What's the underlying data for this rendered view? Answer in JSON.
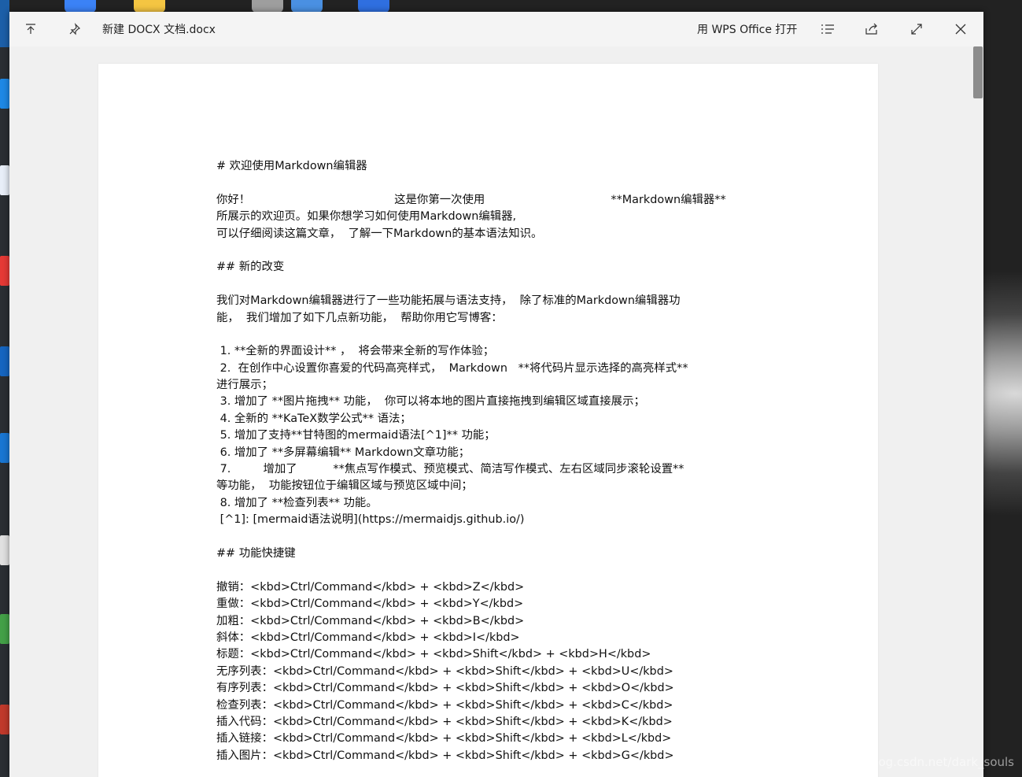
{
  "window": {
    "title": "新建 DOCX 文档.docx",
    "open_with_label": "用 WPS Office 打开"
  },
  "icons": {
    "move_up": "arrow-up-icon",
    "pin": "pin-icon",
    "list": "list-icon",
    "share": "share-icon",
    "fullscreen": "fullscreen-icon",
    "close": "close-icon"
  },
  "document": {
    "lines": [
      "# 欢迎使用Markdown编辑器",
      "",
      "你好！                                        这是你第一次使用                                   **Markdown编辑器**",
      "所展示的欢迎页。如果你想学习如何使用Markdown编辑器,",
      "可以仔细阅读这篇文章，  了解一下Markdown的基本语法知识。",
      "",
      "## 新的改变",
      "",
      "我们对Markdown编辑器进行了一些功能拓展与语法支持，  除了标准的Markdown编辑器功",
      "能，  我们增加了如下几点新功能，  帮助你用它写博客：",
      "",
      " 1. **全新的界面设计** ，  将会带来全新的写作体验；",
      " 2.  在创作中心设置你喜爱的代码高亮样式，  Markdown   **将代码片显示选择的高亮样式**",
      "进行展示；",
      " 3. 增加了 **图片拖拽** 功能，  你可以将本地的图片直接拖拽到编辑区域直接展示；",
      " 4. 全新的 **KaTeX数学公式** 语法；",
      " 5. 增加了支持**甘特图的mermaid语法[^1]** 功能；",
      " 6. 增加了 **多屏幕编辑** Markdown文章功能；",
      " 7.         增加了          **焦点写作模式、预览模式、简洁写作模式、左右区域同步滚轮设置**",
      "等功能，  功能按钮位于编辑区域与预览区域中间；",
      " 8. 增加了 **检查列表** 功能。",
      " [^1]: [mermaid语法说明](https://mermaidjs.github.io/)",
      "",
      "## 功能快捷键",
      "",
      "撤销：<kbd>Ctrl/Command</kbd> + <kbd>Z</kbd>",
      "重做：<kbd>Ctrl/Command</kbd> + <kbd>Y</kbd>",
      "加粗：<kbd>Ctrl/Command</kbd> + <kbd>B</kbd>",
      "斜体：<kbd>Ctrl/Command</kbd> + <kbd>I</kbd>",
      "标题：<kbd>Ctrl/Command</kbd> + <kbd>Shift</kbd> + <kbd>H</kbd>",
      "无序列表：<kbd>Ctrl/Command</kbd> + <kbd>Shift</kbd> + <kbd>U</kbd>",
      "有序列表：<kbd>Ctrl/Command</kbd> + <kbd>Shift</kbd> + <kbd>O</kbd>",
      "检查列表：<kbd>Ctrl/Command</kbd> + <kbd>Shift</kbd> + <kbd>C</kbd>",
      "插入代码：<kbd>Ctrl/Command</kbd> + <kbd>Shift</kbd> + <kbd>K</kbd>",
      "插入链接：<kbd>Ctrl/Command</kbd> + <kbd>Shift</kbd> + <kbd>L</kbd>",
      "插入图片：<kbd>Ctrl/Command</kbd> + <kbd>Shift</kbd> + <kbd>G</kbd>"
    ]
  },
  "watermark": "https://blog.csdn.net/dark_souls",
  "colors": {
    "titlebar": "#f4f4f4",
    "page": "#ffffff",
    "scroll_thumb": "#8c8c8c"
  }
}
